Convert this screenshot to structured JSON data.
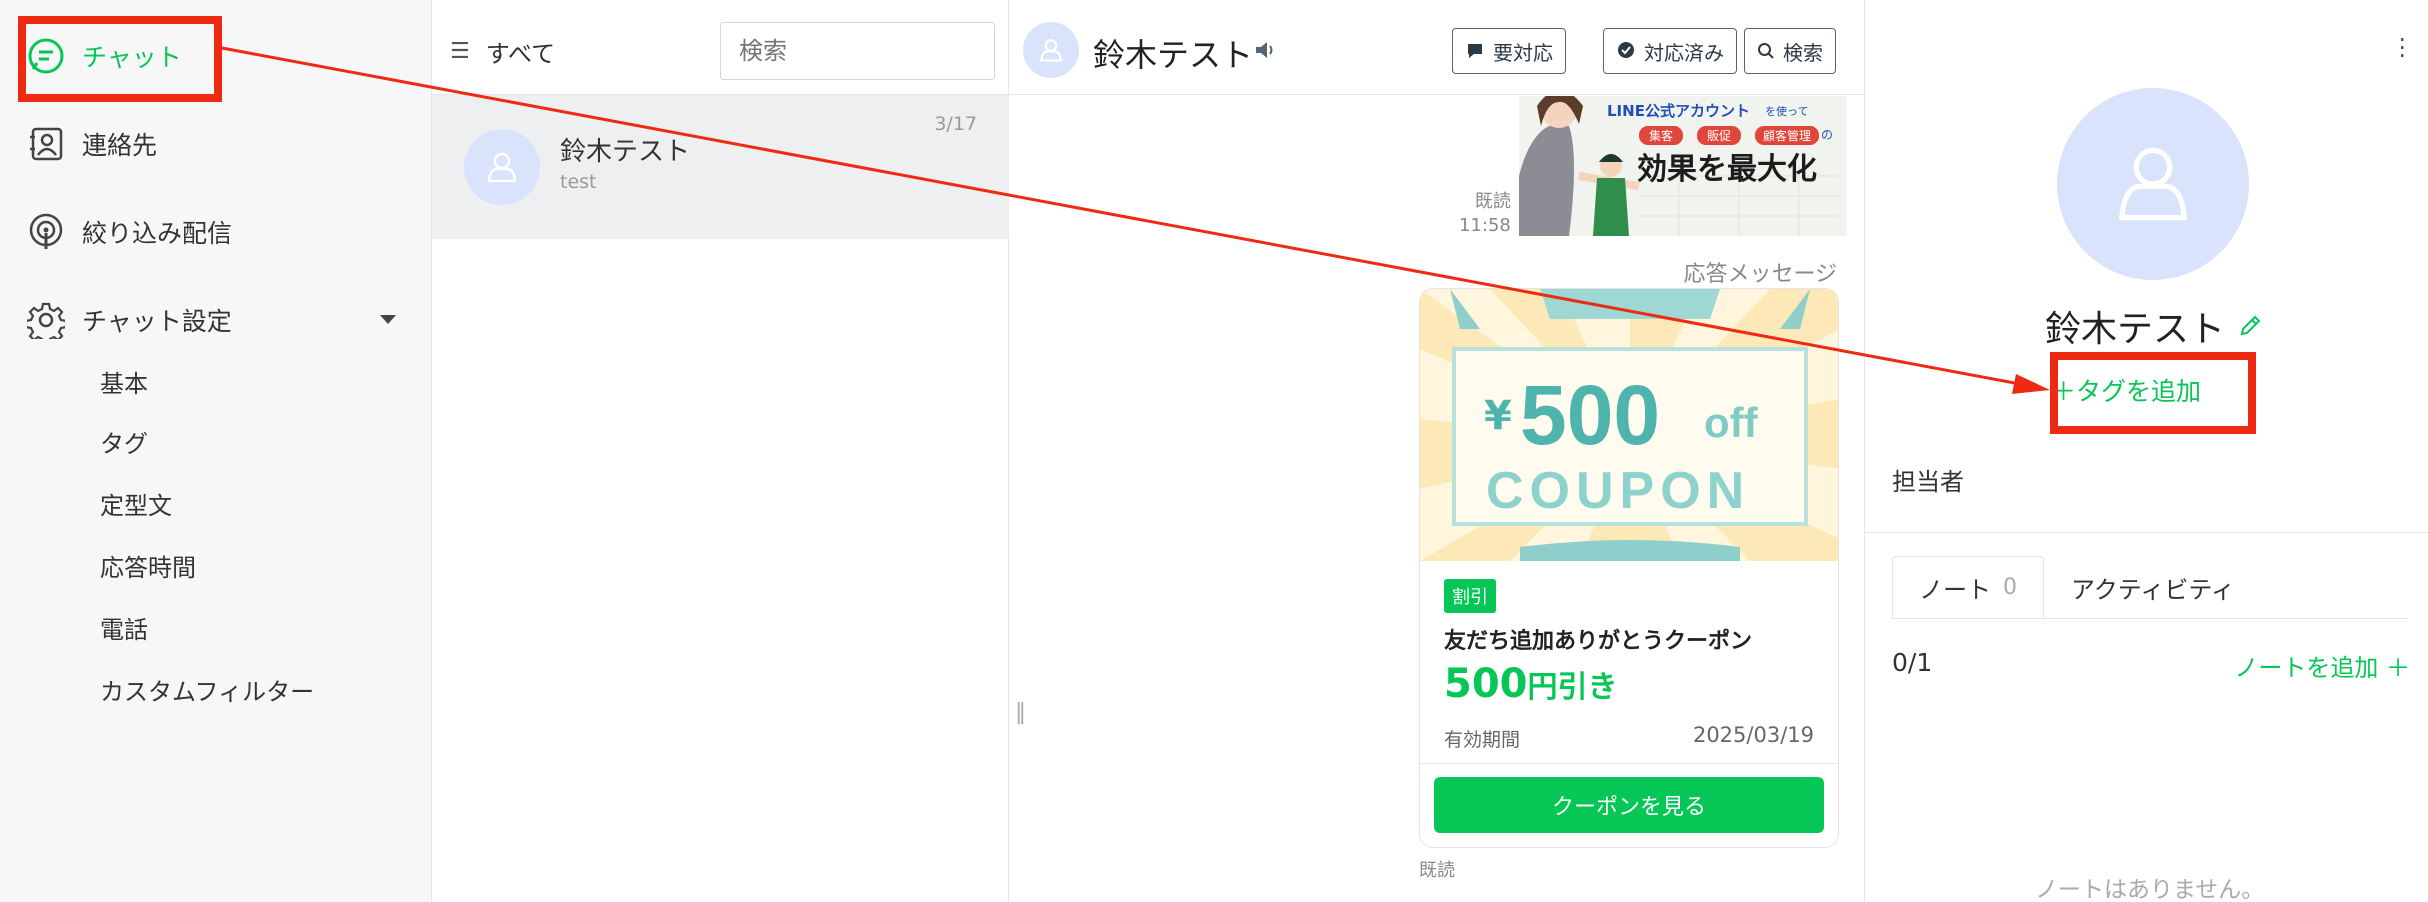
{
  "colors": {
    "accent": "#06c755",
    "annotation": "#ee2a12",
    "avatar_bg": "#d9e3fb"
  },
  "nav": {
    "items": [
      {
        "label": "チャット",
        "icon": "chat-bubble-icon",
        "active": true
      },
      {
        "label": "連絡先",
        "icon": "contact-card-icon"
      },
      {
        "label": "絞り込み配信",
        "icon": "broadcast-icon"
      },
      {
        "label": "チャット設定",
        "icon": "gear-icon"
      }
    ],
    "sub_items": [
      "基本",
      "タグ",
      "定型文",
      "応答時間",
      "電話",
      "カスタムフィルター"
    ]
  },
  "list": {
    "filter_label": "すべて",
    "search_placeholder": "検索",
    "rows": [
      {
        "name": "鈴木テスト",
        "preview": "test",
        "date": "3/17"
      }
    ]
  },
  "chat": {
    "title": "鈴木テスト",
    "buttons": {
      "needs_action": "要対応",
      "done": "対応済み",
      "search": "検索"
    },
    "image_text": {
      "l1": "LINE公式アカウント",
      "l1b": "を使って",
      "t1": "集客",
      "t2": "販促",
      "t3": "顧客管理",
      "t3b": "の",
      "big": "効果を最大化"
    },
    "read_label": "既読",
    "read_time": "11:58",
    "auto_reply_label": "応答メッセージ",
    "coupon": {
      "yen": "¥",
      "amount": "500",
      "off": "off",
      "word": "COUPON",
      "badge": "割引",
      "title": "友だち追加ありがとうクーポン",
      "price_num": "500",
      "price_unit": "円引き",
      "expiry_label": "有効期間",
      "expiry_date": "2025/03/19",
      "button": "クーポンを見る"
    },
    "read_bottom": "既読"
  },
  "profile": {
    "name": "鈴木テスト",
    "add_tag": "＋タグを追加",
    "assignee_label": "担当者",
    "tabs": {
      "note": "ノート",
      "note_count": "0",
      "activity": "アクティビティ"
    },
    "note_counter": "0/1",
    "add_note": "ノートを追加 ＋",
    "empty_notes": "ノートはありません。"
  }
}
